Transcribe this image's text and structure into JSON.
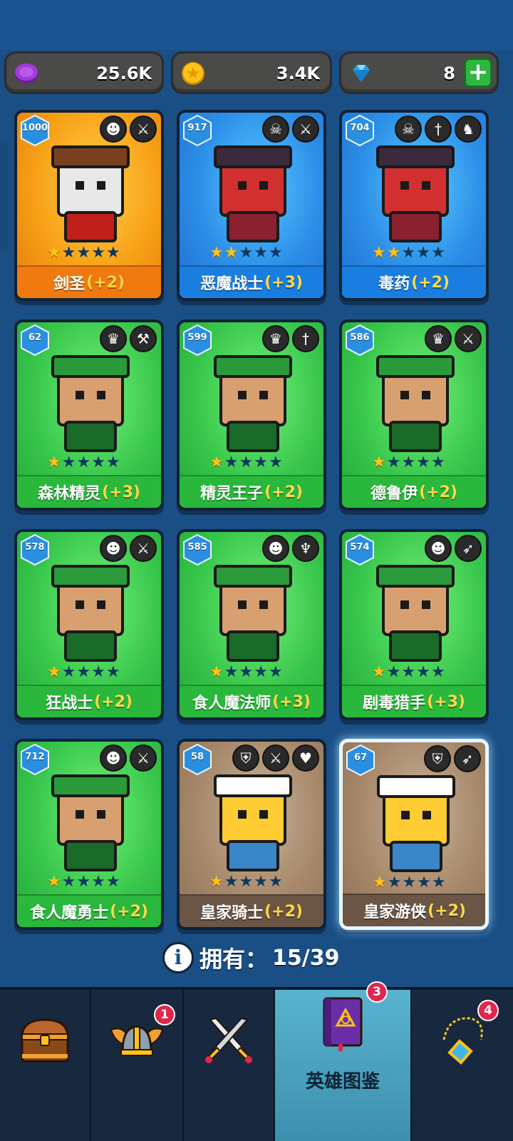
{
  "currencies": [
    {
      "name": "purple-coin-icon",
      "value": "25.6K"
    },
    {
      "name": "gold-coin-icon",
      "value": "3.4K"
    },
    {
      "name": "gem-icon",
      "value": "8",
      "plus": "+"
    }
  ],
  "heroes": [
    {
      "power": "1000",
      "name": "剑圣",
      "bonus": "(+2)",
      "stars": 1,
      "rarity": "gold",
      "icons": [
        "orc-class-icon",
        "sword-icon"
      ]
    },
    {
      "power": "917",
      "name": "恶魔战士",
      "bonus": "(+3)",
      "stars": 2,
      "rarity": "blue",
      "icons": [
        "demon-skull-icon",
        "sword-icon"
      ]
    },
    {
      "power": "704",
      "name": "毒药",
      "bonus": "(+2)",
      "stars": 2,
      "rarity": "blue",
      "icons": [
        "demon-skull-icon",
        "dagger-icon",
        "dragon-icon"
      ]
    },
    {
      "power": "62",
      "name": "森林精灵",
      "bonus": "(+3)",
      "stars": 1,
      "rarity": "green",
      "icons": [
        "elf-class-icon",
        "hammer-icon"
      ]
    },
    {
      "power": "599",
      "name": "精灵王子",
      "bonus": "(+2)",
      "stars": 1,
      "rarity": "green",
      "icons": [
        "elf-class-icon",
        "dagger-icon"
      ]
    },
    {
      "power": "586",
      "name": "德鲁伊",
      "bonus": "(+2)",
      "stars": 1,
      "rarity": "green",
      "icons": [
        "elf-class-icon",
        "sword-icon"
      ]
    },
    {
      "power": "578",
      "name": "狂战士",
      "bonus": "(+2)",
      "stars": 1,
      "rarity": "green",
      "icons": [
        "orc-class-icon",
        "sword-icon"
      ]
    },
    {
      "power": "585",
      "name": "食人魔法师",
      "bonus": "(+3)",
      "stars": 1,
      "rarity": "green",
      "icons": [
        "orc-class-icon",
        "staff-icon"
      ]
    },
    {
      "power": "574",
      "name": "剧毒猎手",
      "bonus": "(+3)",
      "stars": 1,
      "rarity": "green",
      "icons": [
        "orc-class-icon",
        "bow-icon"
      ]
    },
    {
      "power": "712",
      "name": "食人魔勇士",
      "bonus": "(+2)",
      "stars": 1,
      "rarity": "green",
      "icons": [
        "orc-class-icon",
        "sword-icon"
      ]
    },
    {
      "power": "58",
      "name": "皇家骑士",
      "bonus": "(+2)",
      "stars": 1,
      "rarity": "brown",
      "icons": [
        "helmet-icon",
        "sword-icon",
        "heart-icon"
      ]
    },
    {
      "power": "67",
      "name": "皇家游侠",
      "bonus": "(+2)",
      "stars": 1,
      "rarity": "brown",
      "icons": [
        "helmet-icon",
        "bow-icon"
      ],
      "selected": true
    }
  ],
  "owned": {
    "label": "拥有：",
    "value": "15/39"
  },
  "nav": {
    "items": [
      {
        "icon": "treasure-chest-icon",
        "label": "",
        "badge": ""
      },
      {
        "icon": "winged-helmet-icon",
        "label": "",
        "badge": "1"
      },
      {
        "icon": "crossed-swords-icon",
        "label": "",
        "badge": ""
      },
      {
        "icon": "hero-book-icon",
        "label": "英雄图鉴",
        "badge": "3",
        "active": true
      },
      {
        "icon": "amulet-icon",
        "label": "",
        "badge": "4"
      }
    ]
  },
  "colors": {
    "background": "#1a4f86",
    "gold": "#f7a016",
    "blue": "#2c8ee8",
    "green": "#38c74c",
    "brown": "#a7886a",
    "bonus": "#ffd84a"
  }
}
